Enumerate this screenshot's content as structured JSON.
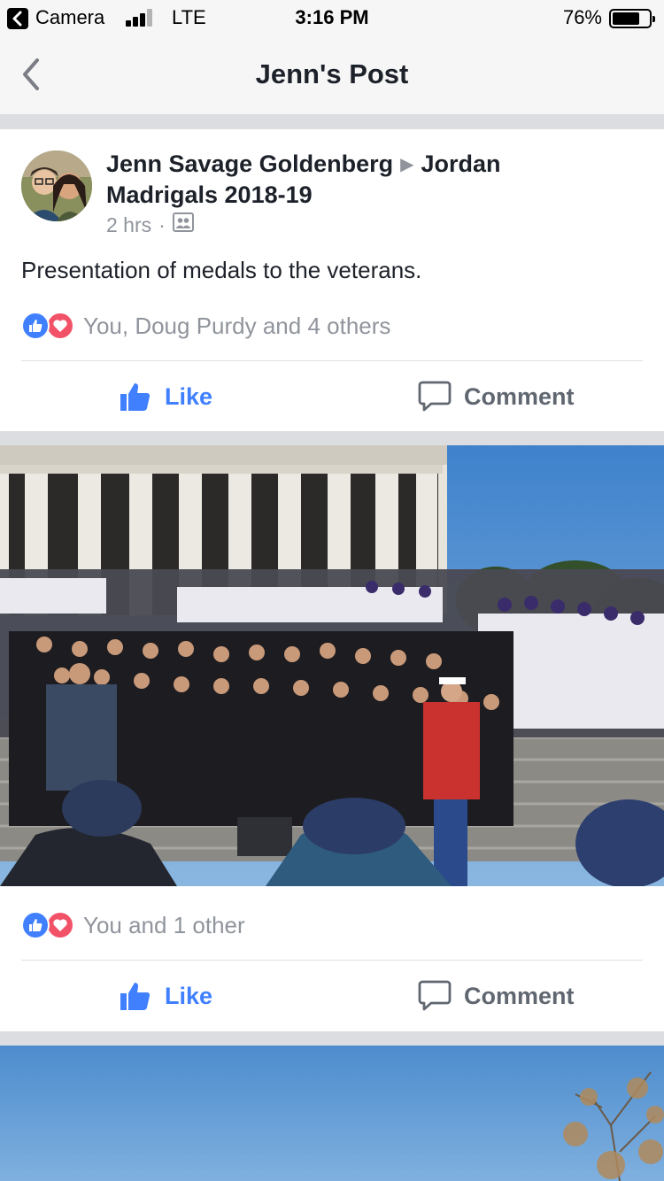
{
  "status_bar": {
    "back_app": "Camera",
    "network": "LTE",
    "time": "3:16 PM",
    "battery_percent": "76%",
    "battery_level": 0.76,
    "signal_bars": 3,
    "signal_bars_total": 4
  },
  "nav": {
    "title": "Jenn's Post",
    "back_icon": "chevron-left-icon"
  },
  "post": {
    "author_name": "Jenn Savage Goldenberg",
    "target_group": "Jordan Madrigals 2018-19",
    "time_ago": "2 hrs",
    "dot": "·",
    "audience_icon": "group-audience-icon",
    "text": "Presentation of medals to the veterans.",
    "reactions_text": "You, Doug Purdy and 4 others",
    "actions": {
      "like_label": "Like",
      "comment_label": "Comment"
    }
  },
  "photo_post": {
    "reactions_text": "You and 1 other",
    "actions": {
      "like_label": "Like",
      "comment_label": "Comment"
    }
  },
  "colors": {
    "accent_blue": "#4080ff",
    "love_red": "#f25268",
    "secondary_text": "#90949c",
    "separator": "#dcdde1"
  }
}
